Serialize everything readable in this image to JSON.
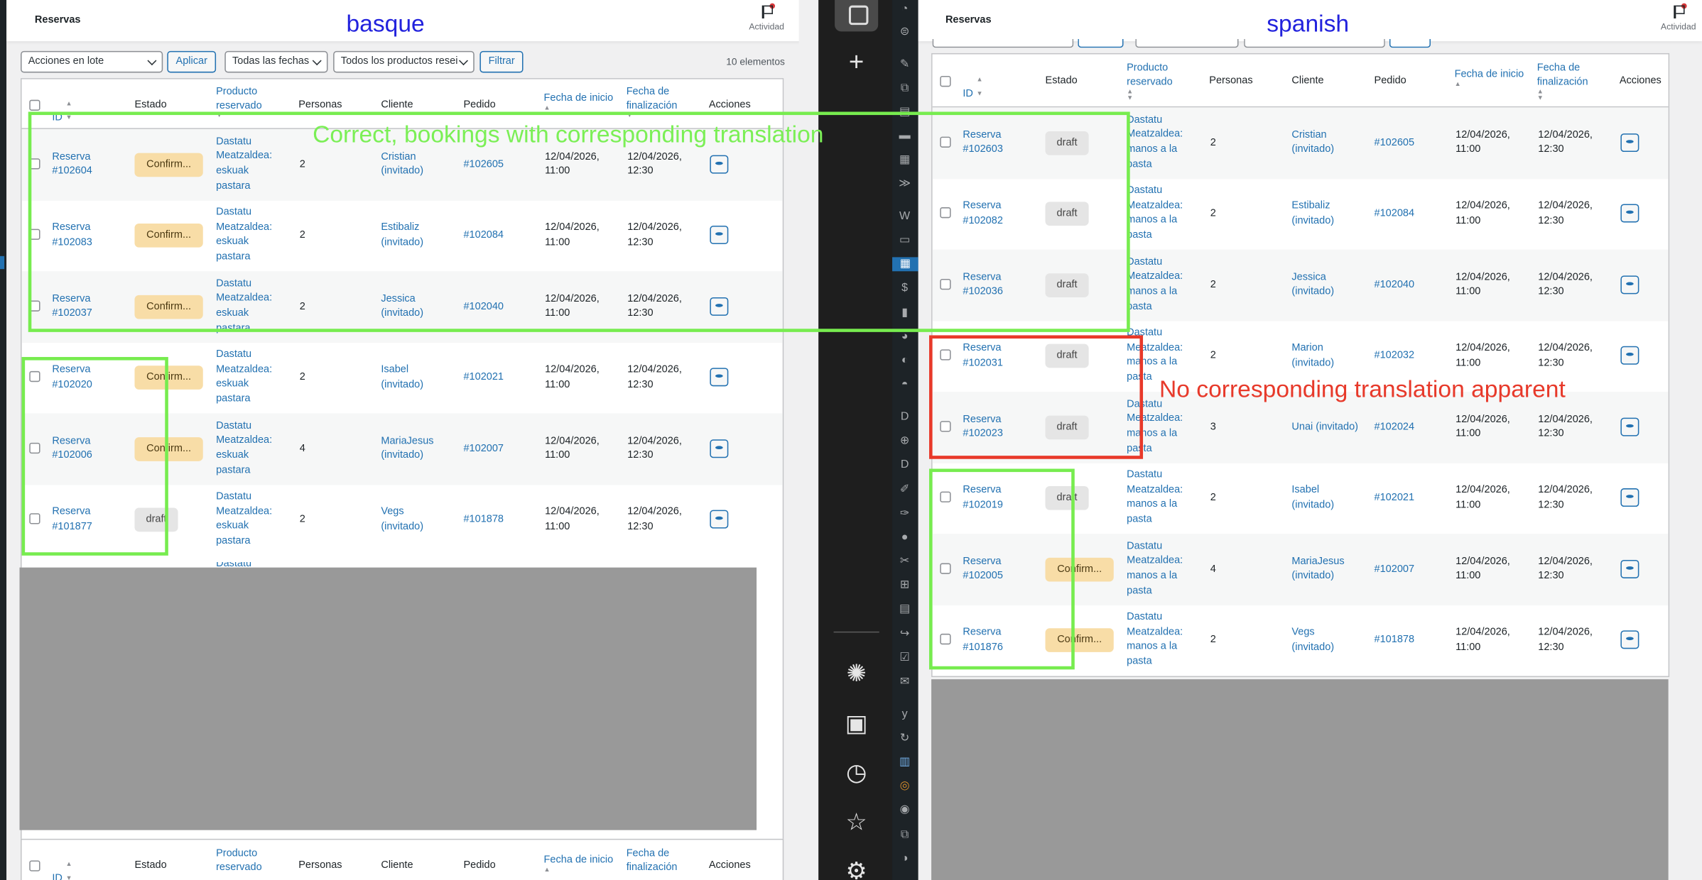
{
  "annotations": {
    "left_language": "basque",
    "right_language": "spanish",
    "green_note": "Correct, bookings with corresponding translation",
    "red_note": "No corresponding translation apparent"
  },
  "colors": {
    "accent": "#2271b1",
    "confirmed_badge": "#f8dda7",
    "draft_badge": "#e5e5e5",
    "annotation_green": "#77ec4f",
    "annotation_red": "#e8392a",
    "annotation_blue": "#2222dd",
    "redaction_gray": "#999999"
  },
  "left": {
    "page_title": "Reservas",
    "activity_label": "Actividad",
    "bulk_actions": "Acciones en lote",
    "apply_label": "Aplicar",
    "dates_filter": "Todas las fechas",
    "products_filter": "Todos los productos resei",
    "filter_label": "Filtrar",
    "items_count": "10 elementos",
    "headers": {
      "id": "ID",
      "estado": "Estado",
      "producto_1": "Producto",
      "producto_2": "reservado",
      "personas": "Personas",
      "cliente": "Cliente",
      "pedido": "Pedido",
      "inicio": "Fecha de inicio",
      "fin_1": "Fecha de",
      "fin_2": "finalización",
      "acciones": "Acciones"
    },
    "partial_next_row": "Dastatu",
    "rows": [
      {
        "id_1": "Reserva",
        "id_2": "#102604",
        "status": "Confirm...",
        "status_type": "confirmed",
        "product": [
          "Dastatu",
          "Meatzaldea:",
          "eskuak",
          "pastara"
        ],
        "people": "2",
        "client_1": "Cristian",
        "client_2": "(invitado)",
        "order": "#102605",
        "start_1": "12/04/2026,",
        "start_2": "11:00",
        "end_1": "12/04/2026,",
        "end_2": "12:30"
      },
      {
        "id_1": "Reserva",
        "id_2": "#102083",
        "status": "Confirm...",
        "status_type": "confirmed",
        "product": [
          "Dastatu",
          "Meatzaldea:",
          "eskuak",
          "pastara"
        ],
        "people": "2",
        "client_1": "Estibaliz",
        "client_2": "(invitado)",
        "order": "#102084",
        "start_1": "12/04/2026,",
        "start_2": "11:00",
        "end_1": "12/04/2026,",
        "end_2": "12:30"
      },
      {
        "id_1": "Reserva",
        "id_2": "#102037",
        "status": "Confirm...",
        "status_type": "confirmed",
        "product": [
          "Dastatu",
          "Meatzaldea:",
          "eskuak",
          "pastara"
        ],
        "people": "2",
        "client_1": "Jessica",
        "client_2": "(invitado)",
        "order": "#102040",
        "start_1": "12/04/2026,",
        "start_2": "11:00",
        "end_1": "12/04/2026,",
        "end_2": "12:30"
      },
      {
        "id_1": "Reserva",
        "id_2": "#102020",
        "status": "Confirm...",
        "status_type": "confirmed",
        "product": [
          "Dastatu",
          "Meatzaldea:",
          "eskuak",
          "pastara"
        ],
        "people": "2",
        "client_1": "Isabel",
        "client_2": "(invitado)",
        "order": "#102021",
        "start_1": "12/04/2026,",
        "start_2": "11:00",
        "end_1": "12/04/2026,",
        "end_2": "12:30"
      },
      {
        "id_1": "Reserva",
        "id_2": "#102006",
        "status": "Confirm...",
        "status_type": "confirmed",
        "product": [
          "Dastatu",
          "Meatzaldea:",
          "eskuak",
          "pastara"
        ],
        "people": "4",
        "client_1": "MariaJesus",
        "client_2": "(invitado)",
        "order": "#102007",
        "start_1": "12/04/2026,",
        "start_2": "11:00",
        "end_1": "12/04/2026,",
        "end_2": "12:30"
      },
      {
        "id_1": "Reserva",
        "id_2": "#101877",
        "status": "draft",
        "status_type": "draft",
        "product": [
          "Dastatu",
          "Meatzaldea:",
          "eskuak",
          "pastara"
        ],
        "people": "2",
        "client_1": "Vegs",
        "client_2": "(invitado)",
        "order": "#101878",
        "start_1": "12/04/2026,",
        "start_2": "11:00",
        "end_1": "12/04/2026,",
        "end_2": "12:30"
      }
    ]
  },
  "right": {
    "page_title": "Reservas",
    "activity_label": "Actividad",
    "headers": {
      "id": "ID",
      "estado": "Estado",
      "producto_1": "Producto",
      "producto_2": "reservado",
      "personas": "Personas",
      "cliente": "Cliente",
      "pedido": "Pedido",
      "inicio": "Fecha de inicio",
      "fin_1": "Fecha de",
      "fin_2": "finalización",
      "acciones": "Acciones"
    },
    "rows": [
      {
        "id_1": "Reserva",
        "id_2": "#102603",
        "status": "draft",
        "status_type": "draft",
        "product": [
          "Dastatu",
          "Meatzaldea:",
          "manos a la",
          "pasta"
        ],
        "people": "2",
        "client_1": "Cristian",
        "client_2": "(invitado)",
        "order": "#102605",
        "start_1": "12/04/2026,",
        "start_2": "11:00",
        "end_1": "12/04/2026,",
        "end_2": "12:30"
      },
      {
        "id_1": "Reserva",
        "id_2": "#102082",
        "status": "draft",
        "status_type": "draft",
        "product": [
          "Dastatu",
          "Meatzaldea:",
          "manos a la",
          "pasta"
        ],
        "people": "2",
        "client_1": "Estibaliz",
        "client_2": "(invitado)",
        "order": "#102084",
        "start_1": "12/04/2026,",
        "start_2": "11:00",
        "end_1": "12/04/2026,",
        "end_2": "12:30"
      },
      {
        "id_1": "Reserva",
        "id_2": "#102036",
        "status": "draft",
        "status_type": "draft",
        "product": [
          "Dastatu",
          "Meatzaldea:",
          "manos a la",
          "pasta"
        ],
        "people": "2",
        "client_1": "Jessica",
        "client_2": "(invitado)",
        "order": "#102040",
        "start_1": "12/04/2026,",
        "start_2": "11:00",
        "end_1": "12/04/2026,",
        "end_2": "12:30"
      },
      {
        "id_1": "Reserva",
        "id_2": "#102031",
        "status": "draft",
        "status_type": "draft",
        "product": [
          "Dastatu",
          "Meatzaldea:",
          "manos a la",
          "pasta"
        ],
        "people": "2",
        "client_1": "Marion",
        "client_2": "(invitado)",
        "order": "#102032",
        "start_1": "12/04/2026,",
        "start_2": "11:00",
        "end_1": "12/04/2026,",
        "end_2": "12:30"
      },
      {
        "id_1": "Reserva",
        "id_2": "#102023",
        "status": "draft",
        "status_type": "draft",
        "product": [
          "Dastatu",
          "Meatzaldea:",
          "manos a la",
          "pasta"
        ],
        "people": "3",
        "client_1": "Unai (invitado)",
        "client_2": "",
        "order": "#102024",
        "start_1": "12/04/2026,",
        "start_2": "11:00",
        "end_1": "12/04/2026,",
        "end_2": "12:30"
      },
      {
        "id_1": "Reserva",
        "id_2": "#102019",
        "status": "draft",
        "status_type": "draft",
        "product": [
          "Dastatu",
          "Meatzaldea:",
          "manos a la",
          "pasta"
        ],
        "people": "2",
        "client_1": "Isabel",
        "client_2": "(invitado)",
        "order": "#102021",
        "start_1": "12/04/2026,",
        "start_2": "11:00",
        "end_1": "12/04/2026,",
        "end_2": "12:30"
      },
      {
        "id_1": "Reserva",
        "id_2": "#102005",
        "status": "Confirm...",
        "status_type": "confirmed",
        "product": [
          "Dastatu",
          "Meatzaldea:",
          "manos a la",
          "pasta"
        ],
        "people": "4",
        "client_1": "MariaJesus",
        "client_2": "(invitado)",
        "order": "#102007",
        "start_1": "12/04/2026,",
        "start_2": "11:00",
        "end_1": "12/04/2026,",
        "end_2": "12:30"
      },
      {
        "id_1": "Reserva",
        "id_2": "#101876",
        "status": "Confirm...",
        "status_type": "confirmed",
        "product": [
          "Dastatu",
          "Meatzaldea:",
          "manos a la",
          "pasta"
        ],
        "people": "2",
        "client_1": "Vegs",
        "client_2": "(invitado)",
        "order": "#101878",
        "start_1": "12/04/2026,",
        "start_2": "11:00",
        "end_1": "12/04/2026,",
        "end_2": "12:30"
      }
    ]
  },
  "sidebar": {
    "app_icons": [
      "openai-icon",
      "remote-desktop-icon",
      "clock-icon",
      "star-icon",
      "settings-gear-icon"
    ],
    "add_icon": "plus-icon"
  }
}
